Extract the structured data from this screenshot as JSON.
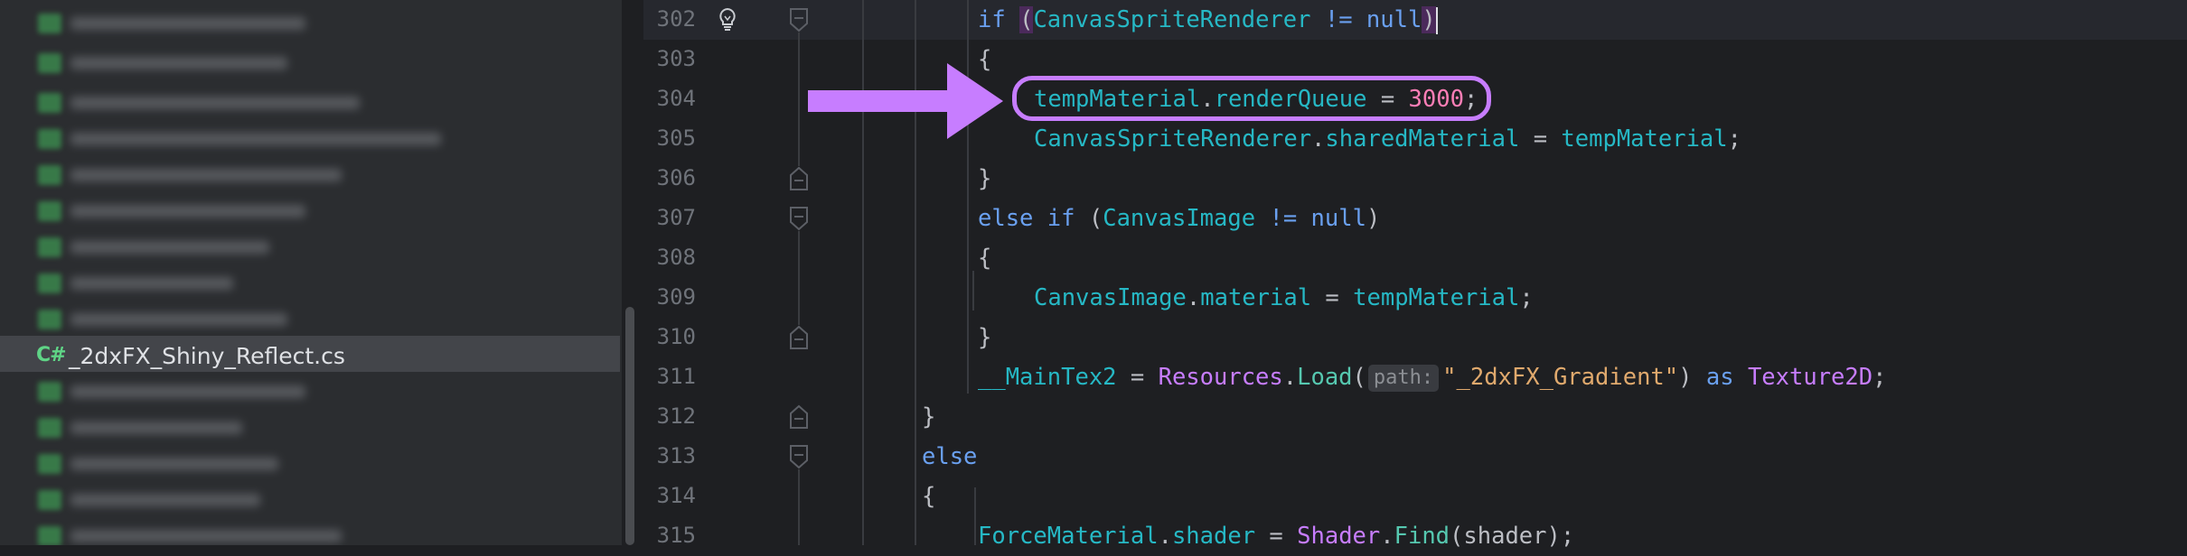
{
  "sidebar": {
    "selected_file": {
      "icon_label": "C#",
      "name": "_2dxFX_Shiny_Reflect.cs"
    }
  },
  "editor": {
    "line_numbers": [
      "302",
      "303",
      "304",
      "305",
      "306",
      "307",
      "308",
      "309",
      "310",
      "311",
      "312",
      "313",
      "314",
      "315"
    ],
    "code": {
      "l302": {
        "kw_if": "if",
        "open": "(",
        "type": "CanvasSpriteRenderer",
        "op": " != ",
        "nul": "null",
        "close": ")"
      },
      "l303": {
        "text": "{"
      },
      "l304": {
        "var": "tempMaterial",
        "dot": ".",
        "prop": "renderQueue",
        "eq": " = ",
        "val": "3000",
        "semi": ";"
      },
      "l305": {
        "type": "CanvasSpriteRenderer",
        "dot": ".",
        "prop": "sharedMaterial",
        "eq": " = ",
        "var": "tempMaterial",
        "semi": ";"
      },
      "l306": {
        "text": "}"
      },
      "l307": {
        "kw_else": "else",
        "kw_if": "if",
        "open": "(",
        "type": "CanvasImage",
        "op": " != ",
        "nul": "null",
        "close": ")"
      },
      "l308": {
        "text": "{"
      },
      "l309": {
        "type": "CanvasImage",
        "dot": ".",
        "prop": "material",
        "eq": " = ",
        "var": "tempMaterial",
        "semi": ";"
      },
      "l310": {
        "text": "}"
      },
      "l311": {
        "var": "__MainTex2",
        "eq": " = ",
        "cls": "Resources",
        "dot": ".",
        "method": "Load",
        "open": "(",
        "hint": "path:",
        "str": "\"_2dxFX_Gradient\"",
        "close": ")",
        "kw_as": "as",
        "type": "Texture2D",
        "semi": ";"
      },
      "l312": {
        "text": "}"
      },
      "l313": {
        "kw_else": "else"
      },
      "l314": {
        "text": "{"
      },
      "l315": {
        "var": "ForceMaterial",
        "dot": ".",
        "prop": "shader",
        "eq": " = ",
        "cls": "Shader",
        "dot2": ".",
        "method": "Find",
        "arg": "(shader)",
        "semi": ";"
      }
    }
  },
  "colors": {
    "annotation": "#c77dff",
    "keyword": "#6aa0f0",
    "type": "#26b8c5",
    "number": "#ff7eb6",
    "string": "#e0a96d"
  },
  "icons": [
    "lightbulb-icon",
    "fold-icon",
    "csharp-file-icon",
    "arrow-annotation-icon"
  ]
}
